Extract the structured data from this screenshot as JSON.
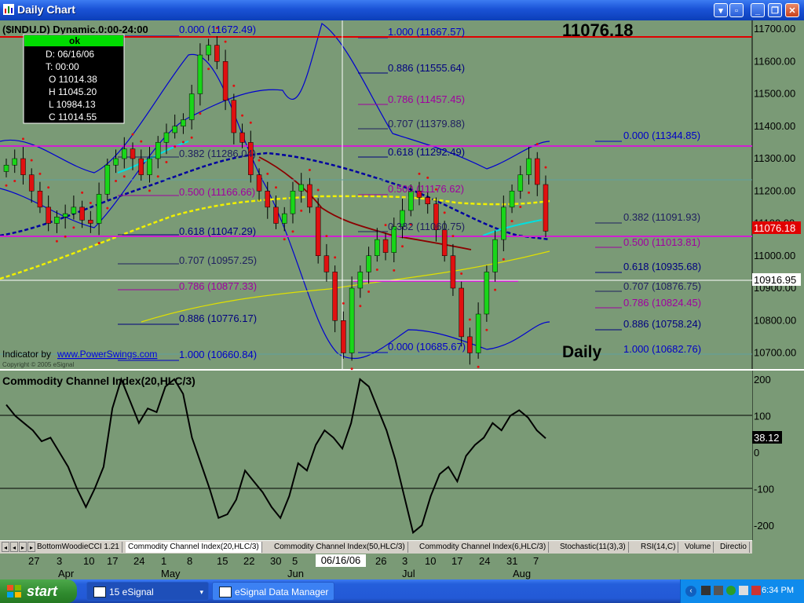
{
  "window": {
    "title": "Daily Chart"
  },
  "chart": {
    "symbol_line": "($INDU.D) Dynamic.0:00-24:00",
    "last_price_big": "11076.18",
    "period_label": "Daily",
    "indicator_credit": "Indicator by",
    "indicator_link": "www.PowerSwings.com",
    "copyright": "Copyright © 2005 eSignal",
    "cursor_box": {
      "status": "ok",
      "lines": [
        "D: 06/16/06",
        "T: 00:00",
        "O  11014.38",
        "H  11045.20",
        "L  10984.13",
        "C  11014.55"
      ]
    },
    "price_axis_labels": [
      "11700.00",
      "11600.00",
      "11500.00",
      "11400.00",
      "11300.00",
      "11200.00",
      "11100.00",
      "11000.00",
      "10900.00",
      "10800.00",
      "10700.00"
    ],
    "last_price_marker": "11076.18",
    "cursor_price_marker": "10916.95",
    "fib_levels": [
      {
        "text": "0.000 (11672.49)",
        "color": "#0000c8"
      },
      {
        "text": "0.382 (11286.04)",
        "color": "#202060"
      },
      {
        "text": "0.500 (11166.66)",
        "color": "#a000a0"
      },
      {
        "text": "0.618 (11047.29)",
        "color": "#000080"
      },
      {
        "text": "0.707 (10957.25)",
        "color": "#202060"
      },
      {
        "text": "0.786 (10877.33)",
        "color": "#a000a0"
      },
      {
        "text": "0.886 (10776.17)",
        "color": "#000080"
      },
      {
        "text": "1.000 (10660.84)",
        "color": "#0000c8"
      },
      {
        "text": "1.000 (11667.57)",
        "color": "#0000c8"
      },
      {
        "text": "0.886 (11555.64)",
        "color": "#000080"
      },
      {
        "text": "0.786 (11457.45)",
        "color": "#a000a0"
      },
      {
        "text": "0.707 (11379.88)",
        "color": "#202060"
      },
      {
        "text": "0.618 (11292.49)",
        "color": "#000080"
      },
      {
        "text": "0.500 (11176.62)",
        "color": "#a000a0"
      },
      {
        "text": "0.382 (11060.75)",
        "color": "#202060"
      },
      {
        "text": "0.000 (10685.67)",
        "color": "#0000c8"
      },
      {
        "text": "0.000 (11344.85)",
        "color": "#0000c8"
      },
      {
        "text": "0.382 (11091.93)",
        "color": "#202060"
      },
      {
        "text": "0.500 (11013.81)",
        "color": "#a000a0"
      },
      {
        "text": "0.618 (10935.68)",
        "color": "#000080"
      },
      {
        "text": "0.707 (10876.75)",
        "color": "#202060"
      },
      {
        "text": "0.786 (10824.45)",
        "color": "#a000a0"
      },
      {
        "text": "0.886 (10758.24)",
        "color": "#000080"
      },
      {
        "text": "1.000 (10682.76)",
        "color": "#0000c8"
      }
    ],
    "closes": [
      11280,
      11300,
      11250,
      11200,
      11150,
      11100,
      11120,
      11130,
      11150,
      11110,
      11100,
      11190,
      11280,
      11300,
      11330,
      11300,
      11250,
      11300,
      11350,
      11380,
      11400,
      11420,
      11500,
      11620,
      11650,
      11600,
      11480,
      11380,
      11350,
      11250,
      11200,
      11150,
      11100,
      11130,
      11200,
      11220,
      11150,
      11000,
      10950,
      10800,
      10700,
      10900,
      10950,
      11000,
      11050,
      11010,
      11090,
      11140,
      11200,
      11180,
      11160,
      11080,
      11000,
      10900,
      10750,
      10700,
      10820,
      10950,
      11050,
      11150,
      11200,
      11250,
      11300,
      11220,
      11076
    ]
  },
  "cci": {
    "title": "Commodity Channel Index(20,HLC/3)",
    "axis_labels": [
      "200",
      "100",
      "0",
      "-100",
      "-200"
    ],
    "last_value": "38.12",
    "values": [
      130,
      100,
      80,
      60,
      30,
      40,
      0,
      -40,
      -100,
      -150,
      -100,
      -40,
      120,
      200,
      140,
      80,
      120,
      110,
      180,
      200,
      160,
      40,
      -30,
      -100,
      -180,
      -170,
      -130,
      -50,
      -80,
      -110,
      -150,
      -180,
      -120,
      -30,
      -50,
      20,
      60,
      40,
      10,
      80,
      200,
      180,
      120,
      60,
      -20,
      -120,
      -220,
      -200,
      -120,
      -60,
      -40,
      -80,
      -10,
      20,
      40,
      80,
      60,
      100,
      115,
      95,
      60,
      38
    ]
  },
  "study_tabs": [
    "BottomWoodieCCI 1.21",
    "Commodity Channel Index(20,HLC/3)",
    "Commodity Channel Index(50,HLC/3)",
    "Commodity Channel Index(6,HLC/3)",
    "Stochastic(11(3),3)",
    "RSI(14,C)",
    "Volume",
    "Directio"
  ],
  "date_axis": {
    "days": [
      "27",
      "3",
      "10",
      "17",
      "24",
      "1",
      "8",
      "15",
      "22",
      "30",
      "5",
      "26",
      "3",
      "10",
      "17",
      "24",
      "31",
      "7"
    ],
    "highlight": "06/16/06",
    "months": [
      "Apr",
      "May",
      "Jun",
      "Jul",
      "Aug"
    ]
  },
  "taskbar": {
    "start": "start",
    "buttons": [
      "15 eSignal",
      "eSignal Data Manager"
    ],
    "clock": "6:34 PM"
  },
  "colors": {
    "background": "#7a9a76",
    "candle_up": "#19d619",
    "candle_down": "#e01010",
    "magenta_line": "#d020d0",
    "red_line": "#e00000"
  }
}
